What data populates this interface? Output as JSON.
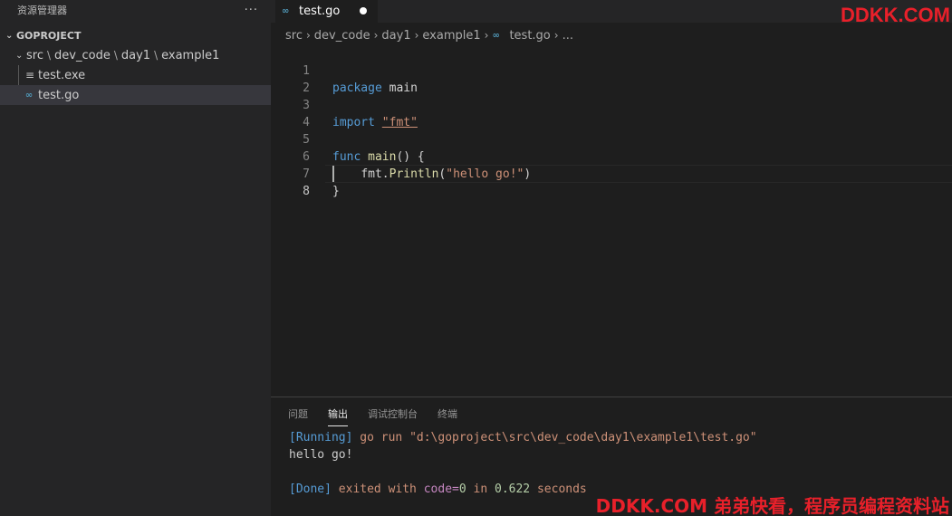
{
  "sidebar": {
    "title": "资源管理器",
    "more_icon": "···",
    "section": "GOPROJECT",
    "folder_path": [
      "src",
      "dev_code",
      "day1",
      "example1"
    ],
    "files": [
      {
        "name": "test.exe",
        "icon": "file-lines-icon"
      },
      {
        "name": "test.go",
        "icon": "go-icon",
        "selected": true
      }
    ]
  },
  "tab": {
    "label": "test.go",
    "icon": "go-icon",
    "dirty": true
  },
  "breadcrumb": [
    "src",
    "dev_code",
    "day1",
    "example1",
    "test.go",
    "..."
  ],
  "editor": {
    "lines": [
      {
        "n": "1"
      },
      {
        "n": "2"
      },
      {
        "n": "3"
      },
      {
        "n": "4"
      },
      {
        "n": "5"
      },
      {
        "n": "6"
      },
      {
        "n": "7"
      },
      {
        "n": "8"
      }
    ],
    "tokens": {
      "package": "package",
      "main": "main",
      "import": "import",
      "fmt": "\"fmt\"",
      "func": "func",
      "main_fn": "main",
      "sig": "() {",
      "pkg": "fmt.",
      "println": "Println",
      "open": "(",
      "hello": "\"hello go!\"",
      "close": ")",
      "brace": "}"
    }
  },
  "panel": {
    "tabs": [
      "问题",
      "输出",
      "调试控制台",
      "终端"
    ],
    "active_tab": "输出",
    "running": "[Running]",
    "command": " go run \"d:\\goproject\\src\\dev_code\\day1\\example1\\test.go\"",
    "output": "hello go!",
    "done": "[Done]",
    "exited": " exited with ",
    "code_label": "code=",
    "code_value": "0",
    "in_word": " in ",
    "duration": "0.622",
    "seconds": " seconds"
  },
  "watermark": {
    "top": "DDKK.COM",
    "bottom": "DDKK.COM 弟弟快看，程序员编程资料站"
  },
  "colors": {
    "keyword": "#569cd6",
    "string": "#ce9178",
    "function": "#dcdcaa",
    "go_icon": "#519aba",
    "watermark": "#e8202a"
  }
}
